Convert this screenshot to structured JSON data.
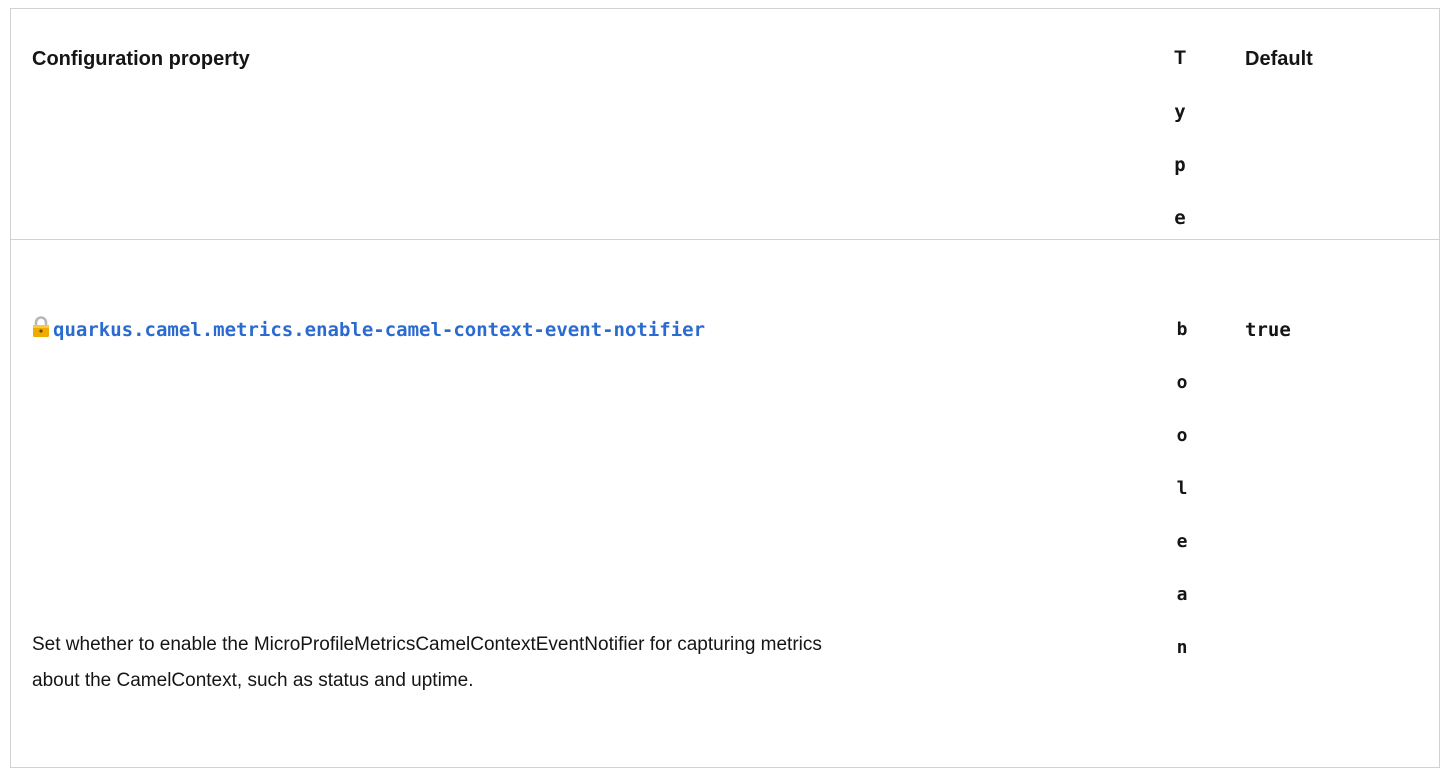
{
  "table": {
    "headers": {
      "property": "Configuration property",
      "type_letters": [
        "T",
        "y",
        "p",
        "e"
      ],
      "default": "Default"
    },
    "rows": [
      {
        "lock_icon": "lock-icon",
        "property": "quarkus.camel.metrics.enable-camel-context-event-notifier",
        "type_letters": [
          "b",
          "o",
          "o",
          "l",
          "e",
          "a",
          "n"
        ],
        "default": "true",
        "description_lines": [
          "Set whether to enable the MicroProfileMetricsCamelContextEventNotifier for capturing metrics",
          "about the CamelContext, such as status and uptime."
        ]
      }
    ]
  },
  "colors": {
    "link": "#2b6bd0",
    "border": "#d2d2d2",
    "text": "#151515",
    "lock": "#f0ab00"
  }
}
